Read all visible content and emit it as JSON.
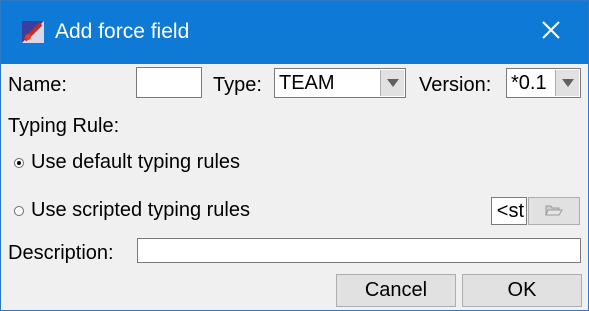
{
  "window": {
    "title": "Add force field"
  },
  "icons": {
    "app": "app-icon",
    "close": "close-icon",
    "dropdown": "chevron-down-icon",
    "folder": "folder-open-icon"
  },
  "form": {
    "name_label": "Name:",
    "name_value": "",
    "type_label": "Type:",
    "type_value": "TEAM",
    "version_label": "Version:",
    "version_value": "*0.1",
    "typing_rule_label": "Typing Rule:",
    "radio_default_label": "Use default typing rules",
    "radio_default_checked": true,
    "radio_scripted_label": "Use scripted typing rules",
    "radio_scripted_checked": false,
    "script_field_value": "st>",
    "description_label": "Description:",
    "description_value": ""
  },
  "buttons": {
    "cancel": "Cancel",
    "ok": "OK"
  },
  "colors": {
    "titlebar": "#0e7ad6",
    "dialog_bg": "#f0f0f0",
    "button_bg": "#e1e1e1"
  }
}
